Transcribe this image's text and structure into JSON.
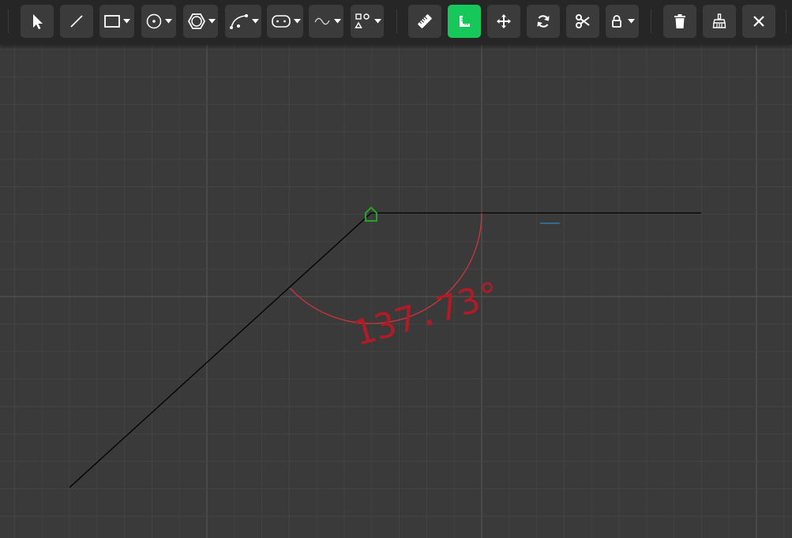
{
  "toolbar": {
    "tools": [
      {
        "name": "select-tool",
        "icon": "cursor-arrow-icon"
      },
      {
        "name": "line-tool",
        "icon": "line-icon"
      },
      {
        "name": "rectangle-tool",
        "icon": "rectangle-icon",
        "dropdown": true
      },
      {
        "name": "circle-tool",
        "icon": "circle-icon",
        "dropdown": true
      },
      {
        "name": "polygon-tool",
        "icon": "hexagon-icon",
        "dropdown": true
      },
      {
        "name": "arc-tool",
        "icon": "arc-icon",
        "dropdown": true
      },
      {
        "name": "slot-tool",
        "icon": "slot-icon",
        "dropdown": true
      },
      {
        "name": "spline-tool",
        "icon": "spline-icon",
        "dropdown": true
      },
      {
        "name": "pattern-tool",
        "icon": "shapes-icon",
        "dropdown": true
      },
      {
        "name": "measure-tool",
        "icon": "ruler-icon"
      },
      {
        "name": "dimension-tool",
        "icon": "angle-ruler-icon",
        "active": true
      },
      {
        "name": "move-tool",
        "icon": "move-arrows-icon"
      },
      {
        "name": "rotate-tool",
        "icon": "rotate-icon"
      },
      {
        "name": "trim-tool",
        "icon": "scissors-icon"
      },
      {
        "name": "lock-tool",
        "icon": "lock-icon",
        "dropdown": true
      },
      {
        "name": "delete-tool",
        "icon": "trash-icon"
      },
      {
        "name": "clear-tool",
        "icon": "broom-icon"
      },
      {
        "name": "close-tool",
        "icon": "close-icon"
      }
    ],
    "active_color": "#16c75a"
  },
  "canvas": {
    "background": "#3a3a3a",
    "grid_minor_color": "#444444",
    "grid_major_color": "#505050",
    "line_color": "#000000",
    "arc_color": "#d0343c",
    "label_color": "#b21b25",
    "origin_marker_color": "#2aa12a",
    "angle_label": "137.73°"
  }
}
